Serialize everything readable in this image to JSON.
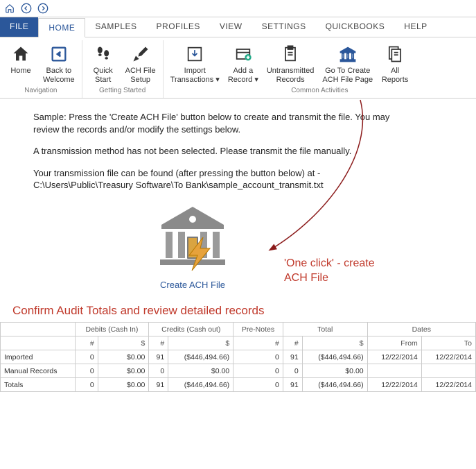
{
  "tabs": {
    "file": "FILE",
    "home": "HOME",
    "samples": "SAMPLES",
    "profiles": "PROFILES",
    "view": "VIEW",
    "settings": "SETTINGS",
    "quickbooks": "QUICKBOOKS",
    "help": "HELP"
  },
  "ribbon": {
    "nav": {
      "home": "Home",
      "back": "Back to\nWelcome",
      "group": "Navigation"
    },
    "getting": {
      "quick": "Quick\nStart",
      "setup": "ACH File\nSetup",
      "group": "Getting Started"
    },
    "common": {
      "import": "Import\nTransactions ▾",
      "add": "Add a\nRecord ▾",
      "untrans": "Untransmitted\nRecords",
      "goto": "Go To Create\nACH File Page",
      "reports": "All\nReports",
      "group": "Common Activities"
    }
  },
  "instr": {
    "p1": "Sample:  Press the 'Create ACH File' button below to create and transmit the file.  You may review the records and/or modify the settings below.",
    "p2": "A transmission method has not been selected.  Please transmit the file manually.",
    "p3": "Your transmission file can be found (after pressing the button below) at - C:\\Users\\Public\\Treasury Software\\To Bank\\sample_account_transmit.txt"
  },
  "create_btn": "Create ACH File",
  "callout": "'One click' - create\nACH File",
  "section_head": "Confirm Audit Totals and review detailed records",
  "table": {
    "group_headers": [
      "",
      "Debits (Cash In)",
      "Credits (Cash out)",
      "Pre-Notes",
      "Total",
      "Dates"
    ],
    "sub_headers": [
      "",
      "#",
      "$",
      "#",
      "$",
      "#",
      "#",
      "$",
      "From",
      "To"
    ],
    "rows": [
      {
        "label": "Imported",
        "vals": [
          "0",
          "$0.00",
          "91",
          "($446,494.66)",
          "0",
          "91",
          "($446,494.66)",
          "12/22/2014",
          "12/22/2014"
        ]
      },
      {
        "label": "Manual Records",
        "vals": [
          "0",
          "$0.00",
          "0",
          "$0.00",
          "0",
          "0",
          "$0.00",
          "",
          ""
        ]
      },
      {
        "label": "Totals",
        "vals": [
          "0",
          "$0.00",
          "91",
          "($446,494.66)",
          "0",
          "91",
          "($446,494.66)",
          "12/22/2014",
          "12/22/2014"
        ]
      }
    ]
  }
}
